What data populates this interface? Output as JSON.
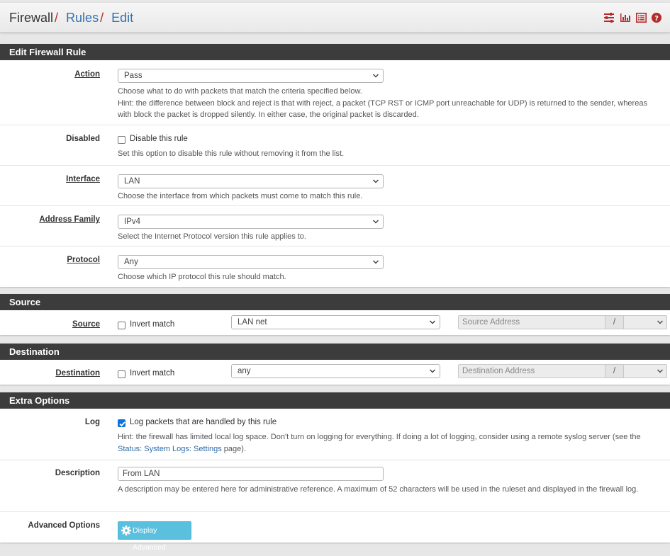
{
  "breadcrumb": {
    "root": "Firewall",
    "rules": "Rules",
    "edit": "Edit",
    "sep": "/"
  },
  "header_icons": [
    "sliders-icon",
    "bar-chart-icon",
    "list-icon",
    "help-icon"
  ],
  "colors": {
    "accent_red": "#b52b2b",
    "link_blue": "#3572b0",
    "panel_header": "#3c3c3c",
    "button_info": "#5bc0de",
    "checkbox_checked": "#0b74d9"
  },
  "edit_rule": {
    "title": "Edit Firewall Rule",
    "action": {
      "label": "Action",
      "value": "Pass",
      "help1": "Choose what to do with packets that match the criteria specified below.",
      "help2": "Hint: the difference between block and reject is that with reject, a packet (TCP RST or ICMP port unreachable for UDP) is returned to the sender, whereas with block the packet is dropped silently. In either case, the original packet is discarded."
    },
    "disabled": {
      "label": "Disabled",
      "checkbox_label": "Disable this rule",
      "checked": false,
      "help": "Set this option to disable this rule without removing it from the list."
    },
    "interface": {
      "label": "Interface",
      "value": "LAN",
      "help": "Choose the interface from which packets must come to match this rule."
    },
    "address_family": {
      "label": "Address Family",
      "value": "IPv4",
      "help": "Select the Internet Protocol version this rule applies to."
    },
    "protocol": {
      "label": "Protocol",
      "value": "Any",
      "help": "Choose which IP protocol this rule should match."
    }
  },
  "source": {
    "title": "Source",
    "label": "Source",
    "invert_label": "Invert match",
    "invert_checked": false,
    "value": "LAN net",
    "address_placeholder": "Source Address",
    "slash": "/"
  },
  "destination": {
    "title": "Destination",
    "label": "Destination",
    "invert_label": "Invert match",
    "invert_checked": false,
    "value": "any",
    "address_placeholder": "Destination Address",
    "slash": "/"
  },
  "extra": {
    "title": "Extra Options",
    "log": {
      "label": "Log",
      "checkbox_label": "Log packets that are handled by this rule",
      "checked": true,
      "help_pre": "Hint: the firewall has limited local log space. Don't turn on logging for everything. If doing a lot of logging, consider using a remote syslog server (see the ",
      "help_link": "Status: System Logs: Settings",
      "help_post": " page)."
    },
    "description": {
      "label": "Description",
      "value": "From LAN",
      "help": "A description may be entered here for administrative reference. A maximum of 52 characters will be used in the ruleset and displayed in the firewall log."
    },
    "advanced": {
      "label": "Advanced Options",
      "button": "Display Advanced"
    }
  }
}
